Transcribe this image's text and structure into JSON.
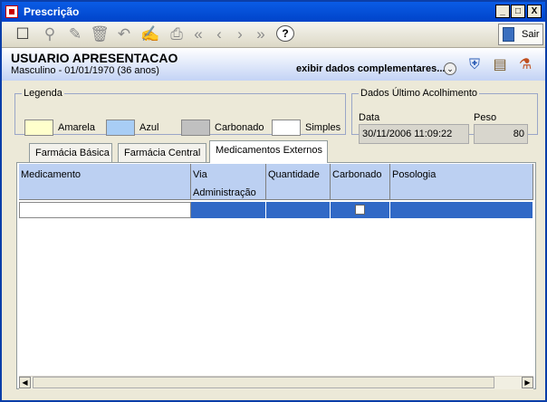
{
  "window": {
    "title": "Prescrição",
    "min": "_",
    "max": "□",
    "close": "X"
  },
  "toolbar": {
    "help": "?",
    "sair": "Sair"
  },
  "patient": {
    "name": "USUARIO APRESENTACAO",
    "info": "Masculino - 01/01/1970 (36 anos)",
    "more": "exibir dados complementares..."
  },
  "legenda": {
    "title": "Legenda",
    "items": [
      {
        "label": "Amarela",
        "color": "#ffffcc"
      },
      {
        "label": "Azul",
        "color": "#a8cdf5"
      },
      {
        "label": "Carbonado",
        "color": "#c0c0c0"
      },
      {
        "label": "Simples",
        "color": "#ffffff"
      }
    ]
  },
  "acolhimento": {
    "title": "Dados Último Acolhimento",
    "data_label": "Data",
    "data_value": "30/11/2006 11:09:22",
    "peso_label": "Peso",
    "peso_value": "80"
  },
  "tabs": [
    "Farmácia Básica",
    "Farmácia Central",
    "Medicamentos Externos"
  ],
  "grid": {
    "columns": [
      "Medicamento",
      "Via Administração",
      "Quantidade",
      "Carbonado",
      "Posologia"
    ]
  },
  "colors": {
    "selection": "#3169c6",
    "header": "#bcd0f2"
  }
}
